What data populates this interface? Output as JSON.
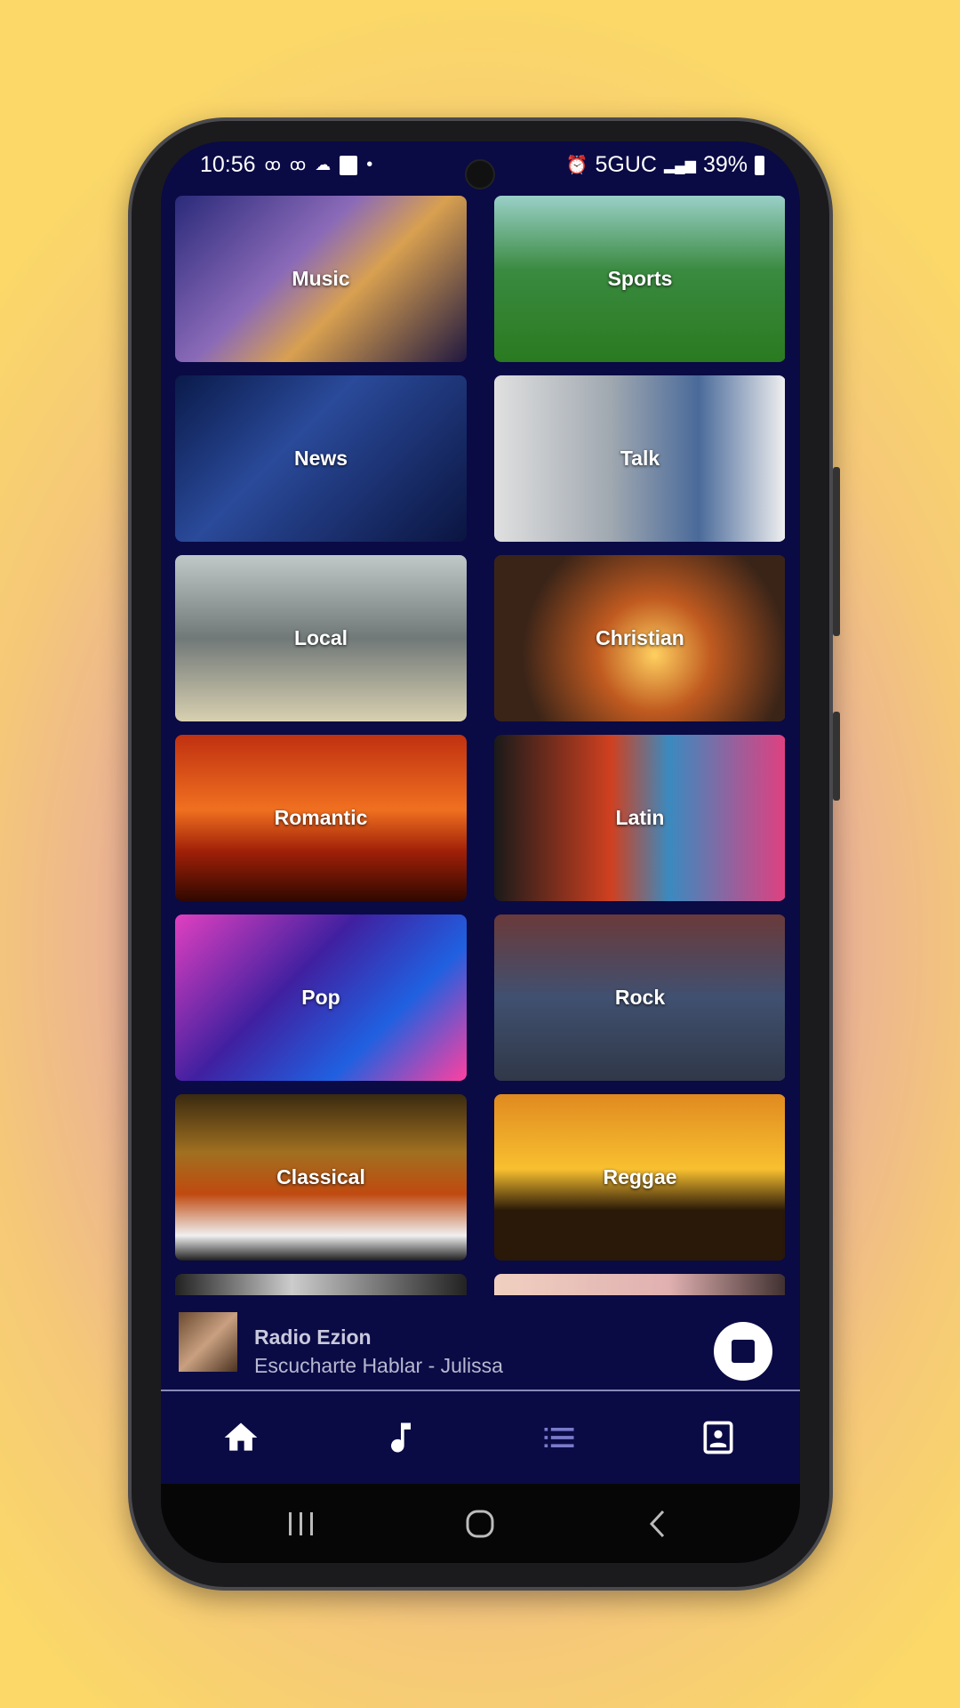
{
  "status_bar": {
    "time": "10:56",
    "network": "5GUC",
    "battery": "39%",
    "icons": [
      "voicemail-icon",
      "voicemail-icon",
      "cloud-icon",
      "gallery-icon",
      "dot-icon",
      "alarm-icon",
      "signal-icon",
      "battery-icon"
    ]
  },
  "categories": [
    {
      "label": "Music",
      "bg": "linear-gradient(135deg,#2a2a7a,#8a6ab8 40%,#d8a050 60%,#201840)"
    },
    {
      "label": "Sports",
      "bg": "linear-gradient(180deg,#9ad0c8 0%,#3a8a40 45%,#2a7a20 100%)"
    },
    {
      "label": "News",
      "bg": "linear-gradient(135deg,#0a1a4a,#2a4a9a 40%,#0a1440)"
    },
    {
      "label": "Talk",
      "bg": "linear-gradient(90deg,#e0e0e0,#a0a8b0 40%,#4a6a9a 70%,#f0f0f0)"
    },
    {
      "label": "Local",
      "bg": "linear-gradient(180deg,#c0c8c8,#707878 50%,#d8d0b0)"
    },
    {
      "label": "Christian",
      "bg": "radial-gradient(circle at 55% 60%,#ffd060,#c05a20 30%,#3a2418 70%)"
    },
    {
      "label": "Romantic",
      "bg": "linear-gradient(180deg,#c03010,#f07020 45%,#a02008 70%,#300800)"
    },
    {
      "label": "Latin",
      "bg": "linear-gradient(90deg,#1a1a1a,#d04020 40%,#3a8ac0 60%,#e04080)"
    },
    {
      "label": "Pop",
      "bg": "linear-gradient(135deg,#e040c0,#4020a0 40%,#2060e0 70%,#ff40a0)"
    },
    {
      "label": "Rock",
      "bg": "linear-gradient(180deg,#6a3a3a,#405070 50%,#303848)"
    },
    {
      "label": "Classical",
      "bg": "linear-gradient(180deg,#3a2a10,#a07020 35%,#c04a10 60%,#f0f0f0 85%,#202020)"
    },
    {
      "label": "Reggae",
      "bg": "linear-gradient(180deg,#e08a20,#f8c030 45%,#2a1808 70%)"
    },
    {
      "label": "",
      "bg": "linear-gradient(90deg,#222,#ccc 40%,#222)"
    },
    {
      "label": "",
      "bg": "linear-gradient(90deg,#f0d0c0,#e0b0b0 60%,#403030)"
    }
  ],
  "player": {
    "station": "Radio Ezion",
    "track": "Escucharte Hablar - Julissa"
  },
  "bottom_nav": [
    {
      "name": "home"
    },
    {
      "name": "music"
    },
    {
      "name": "list"
    },
    {
      "name": "contacts"
    }
  ],
  "colors": {
    "background": "#0a0a45",
    "inactive_icon": "#7a7acc"
  }
}
